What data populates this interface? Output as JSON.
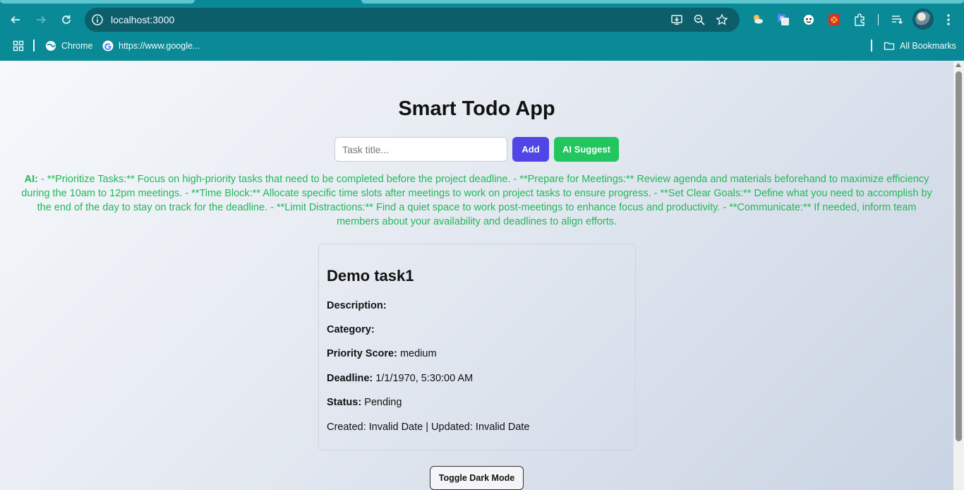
{
  "browser": {
    "url": "localhost:3000",
    "bookmarks": [
      {
        "label": "Chrome",
        "icon": "globe-icon"
      },
      {
        "label": "https://www.google...",
        "icon": "google-icon"
      }
    ],
    "all_bookmarks_label": "All Bookmarks"
  },
  "app": {
    "title": "Smart Todo App",
    "input_placeholder": "Task title...",
    "add_label": "Add",
    "ai_suggest_label": "AI Suggest",
    "ai_prefix": "AI:",
    "ai_text": " - **Prioritize Tasks:** Focus on high-priority tasks that need to be completed before the project deadline. - **Prepare for Meetings:** Review agenda and materials beforehand to maximize efficiency during the 10am to 12pm meetings. - **Time Block:** Allocate specific time slots after meetings to work on project tasks to ensure progress. - **Set Clear Goals:** Define what you need to accomplish by the end of the day to stay on track for the deadline. - **Limit Distractions:** Find a quiet space to work post-meetings to enhance focus and productivity. - **Communicate:** If needed, inform team members about your availability and deadlines to align efforts.",
    "toggle_dark_label": "Toggle Dark Mode"
  },
  "task": {
    "title": "Demo task1",
    "description_label": "Description:",
    "description_value": "",
    "category_label": "Category:",
    "category_value": "",
    "priority_label": "Priority Score:",
    "priority_value": "medium",
    "deadline_label": "Deadline:",
    "deadline_value": "1/1/1970, 5:30:00 AM",
    "status_label": "Status:",
    "status_value": "Pending",
    "meta": "Created: Invalid Date | Updated: Invalid Date"
  },
  "colors": {
    "chrome_teal": "#0a8a96",
    "add_button": "#4f46e5",
    "ai_button": "#22c55e",
    "ai_text": "#22b85a"
  }
}
